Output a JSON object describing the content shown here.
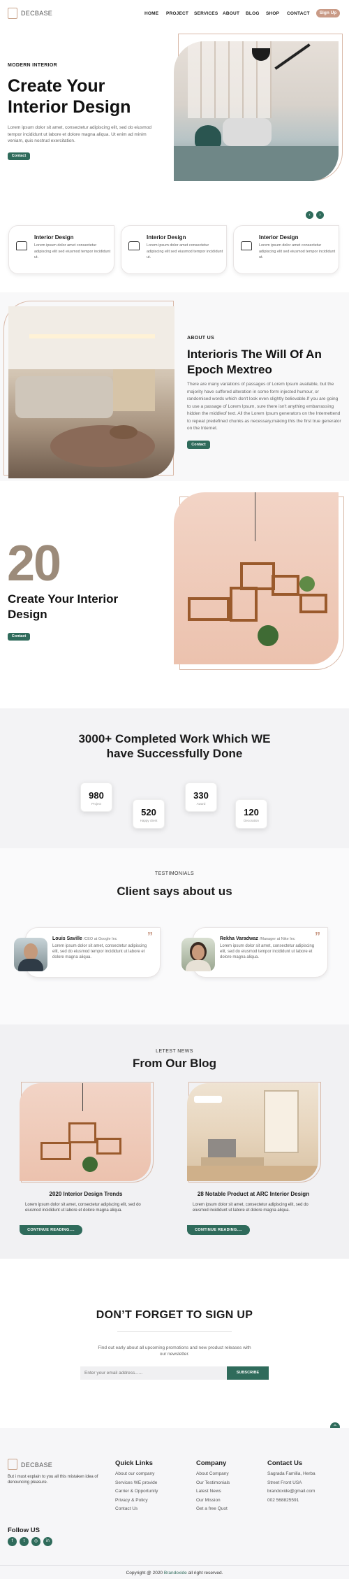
{
  "header": {
    "logo_text": "DECBASE",
    "nav": [
      "HOME",
      "PROJECT",
      "SERVICES",
      "ABOUT",
      "BLOG",
      "SHOP",
      "CONTACT"
    ],
    "signup_label": "Sign Up"
  },
  "hero": {
    "eyebrow": "MODERN INTERIOR",
    "title_line1": "Create Your",
    "title_line2": "Interior Design",
    "text": "Lorem ipsum dolor sit amet, consectetur adipiscing elit, sed do eiusmod tempor incididunt ut labore et dolore magna aliqua. Ut enim ad minim veniam, quis nostrud exercitation.",
    "button": "Contact",
    "prev_icon": "chevron-left-icon",
    "next_icon": "chevron-right-icon"
  },
  "features": [
    {
      "title": "Interior Design",
      "text": "Lorem ipsum dolor amet consectetur adipiscing elit sed eiusmod tempor incididunt ut.",
      "icon": "sofa-icon"
    },
    {
      "title": "Interior Design",
      "text": "Lorem ipsum dolor amet consectetur adipiscing elit sed eiusmod tempor incididunt ut.",
      "icon": "sofa-icon"
    },
    {
      "title": "Interior Design",
      "text": "Lorem ipsum dolor amet consectetur adipiscing elit sed eiusmod tempor incididunt ut.",
      "icon": "sofa-icon"
    }
  ],
  "about": {
    "eyebrow": "ABOUT US",
    "title_line1": "Interioris The Will Of An",
    "title_line2": "Epoch Mextreo",
    "text": "There are many variations of passages of Lorem Ipsum available, but the majority have suffered alteration in some form injected humour, or randomised words which don't look even slightly believable.If you are going to use a passage of Lorem Ipsum, sure there isn't anything embarrassing hidden the middleof text. All the Lorem Ipsum generators on the Internettend to repeat predefined chunks as necessary,making this the first true generator on the Internet.",
    "button": "Contact"
  },
  "section20": {
    "big_number": "20",
    "title_line1": "Create Your Interior",
    "title_line2": "Design",
    "button": "Contact"
  },
  "stats": {
    "title_line1": "3000+ Completed Work Which WE",
    "title_line2": "have Successfully Done",
    "items": [
      {
        "num": "980",
        "label": "Project"
      },
      {
        "num": "520",
        "label": "Happy client"
      },
      {
        "num": "330",
        "label": "Award"
      },
      {
        "num": "120",
        "label": "Decoration"
      }
    ]
  },
  "testimonials": {
    "eyebrow": "TESTIMONIALS",
    "title": "Client says about us",
    "items": [
      {
        "name": "Louis Saville",
        "role": "/CEO at Google Inc",
        "text": "Lorem ipsum dolor sit amet, consectetur adipiscing elit, sed do eiusmod tempor incididunt ut labore et dolore magna aliqua."
      },
      {
        "name": "Rekha Varadwaz",
        "role": "/Manager at Nike Inc",
        "text": "Lorem ipsum dolor sit amet, consectetur adipiscing elit, sed do eiusmod tempor incididunt ut labore et dolore magna aliqua."
      }
    ]
  },
  "blog": {
    "eyebrow": "LETEST NEWS",
    "title": "From Our Blog",
    "posts": [
      {
        "title": "2020 Interior Design Trends",
        "text": "Lorem ipsum dolor sit amet, consectetur adipiscing elit, sed do eiusmod incididunt ut labore et dolore magna aliqua.",
        "button": "CONTINUE READING...."
      },
      {
        "title": "28 Notable Product at ARC Interior Design",
        "text": "Lorem ipsum dolor sit amet, consectetur adipiscing elit, sed do eiusmod incididunt ut labore et dolore magna aliqua.",
        "button": "CONTINUE READING...."
      }
    ]
  },
  "newsletter": {
    "title": "DON’T FORGET TO SIGN UP",
    "text": "Find out early about all upcoming promotions and new product releases with our newsletter.",
    "placeholder": "Enter your email address......",
    "button": "SUBSCRIBE"
  },
  "footer": {
    "logo_text": "DECBASE",
    "about": "But i must explain to you all this mistaken idea of denouncing pleasure.",
    "follow_title": "Follow US",
    "social_icons": [
      "facebook-icon",
      "twitter-icon",
      "instagram-icon",
      "linkedin-icon"
    ],
    "quick_title": "Quick Links",
    "quick_links": [
      "About our company",
      "Services WE provide",
      "Carrier & Opportunity",
      "Privacy & Policy",
      "Contact Us"
    ],
    "company_title": "Company",
    "company_links": [
      "About Company",
      "Our Testimonials",
      "Latest News",
      "Our Mission",
      "Get a free Quot"
    ],
    "contact_title": "Contact Us",
    "contact_lines": [
      "Sagrada Familia, Herba",
      "Street Front USA",
      "brandoxide@gmail.com",
      "002 568825591"
    ],
    "copyright_prefix": "Copyright @ 2020 ",
    "copyright_brand": "Brandoxide",
    "copyright_suffix": " all right reserved."
  },
  "colors": {
    "accent": "#2f6b5b",
    "brand": "#c99a86"
  }
}
